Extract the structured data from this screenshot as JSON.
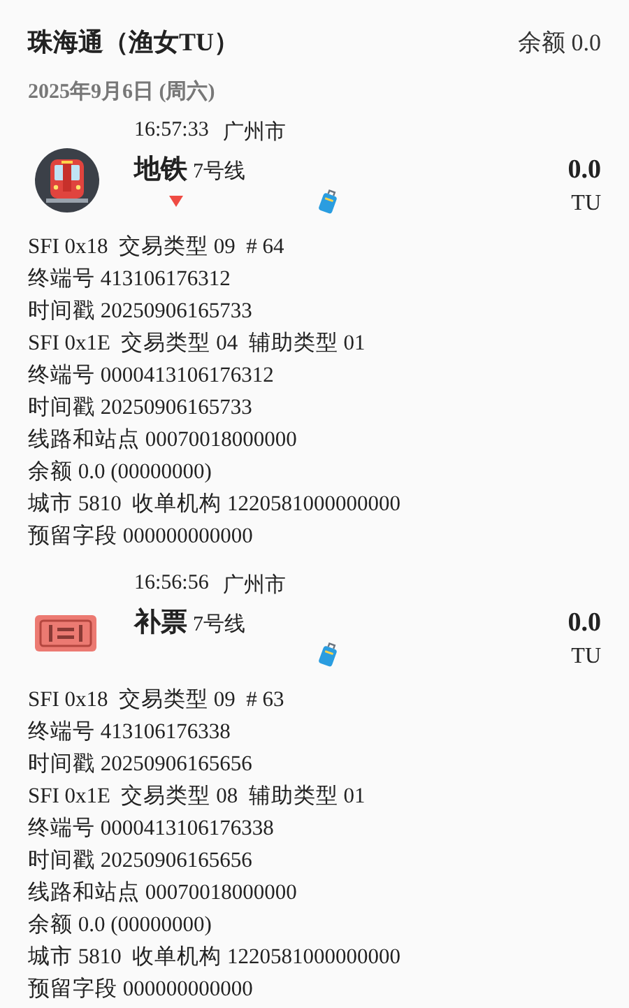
{
  "header": {
    "title": "珠海通（渔女TU）",
    "balance": "余额 0.0"
  },
  "date": "2025年9月6日 (周六)",
  "records": [
    {
      "kind": "subway",
      "time": "16:57:33",
      "city": "广州市",
      "type": "地铁",
      "line": "7号线",
      "amount": "0.0",
      "unit": "TU",
      "down_marker": true,
      "lines": [
        "SFI 0x18  交易类型 09  # 64",
        "终端号 413106176312",
        "时间戳 20250906165733",
        "SFI 0x1E  交易类型 04  辅助类型 01",
        "终端号 0000413106176312",
        "时间戳 20250906165733",
        "线路和站点 00070018000000",
        "余额 0.0 (00000000)",
        "城市 5810  收单机构 1220581000000000",
        "预留字段 000000000000"
      ]
    },
    {
      "kind": "ticket",
      "time": "16:56:56",
      "city": "广州市",
      "type": "补票",
      "line": "7号线",
      "amount": "0.0",
      "unit": "TU",
      "down_marker": false,
      "lines": [
        "SFI 0x18  交易类型 09  # 63",
        "终端号 413106176338",
        "时间戳 20250906165656",
        "SFI 0x1E  交易类型 08  辅助类型 01",
        "终端号 0000413106176338",
        "时间戳 20250906165656",
        "线路和站点 00070018000000",
        "余额 0.0 (00000000)",
        "城市 5810  收单机构 1220581000000000",
        "预留字段 000000000000"
      ]
    }
  ]
}
